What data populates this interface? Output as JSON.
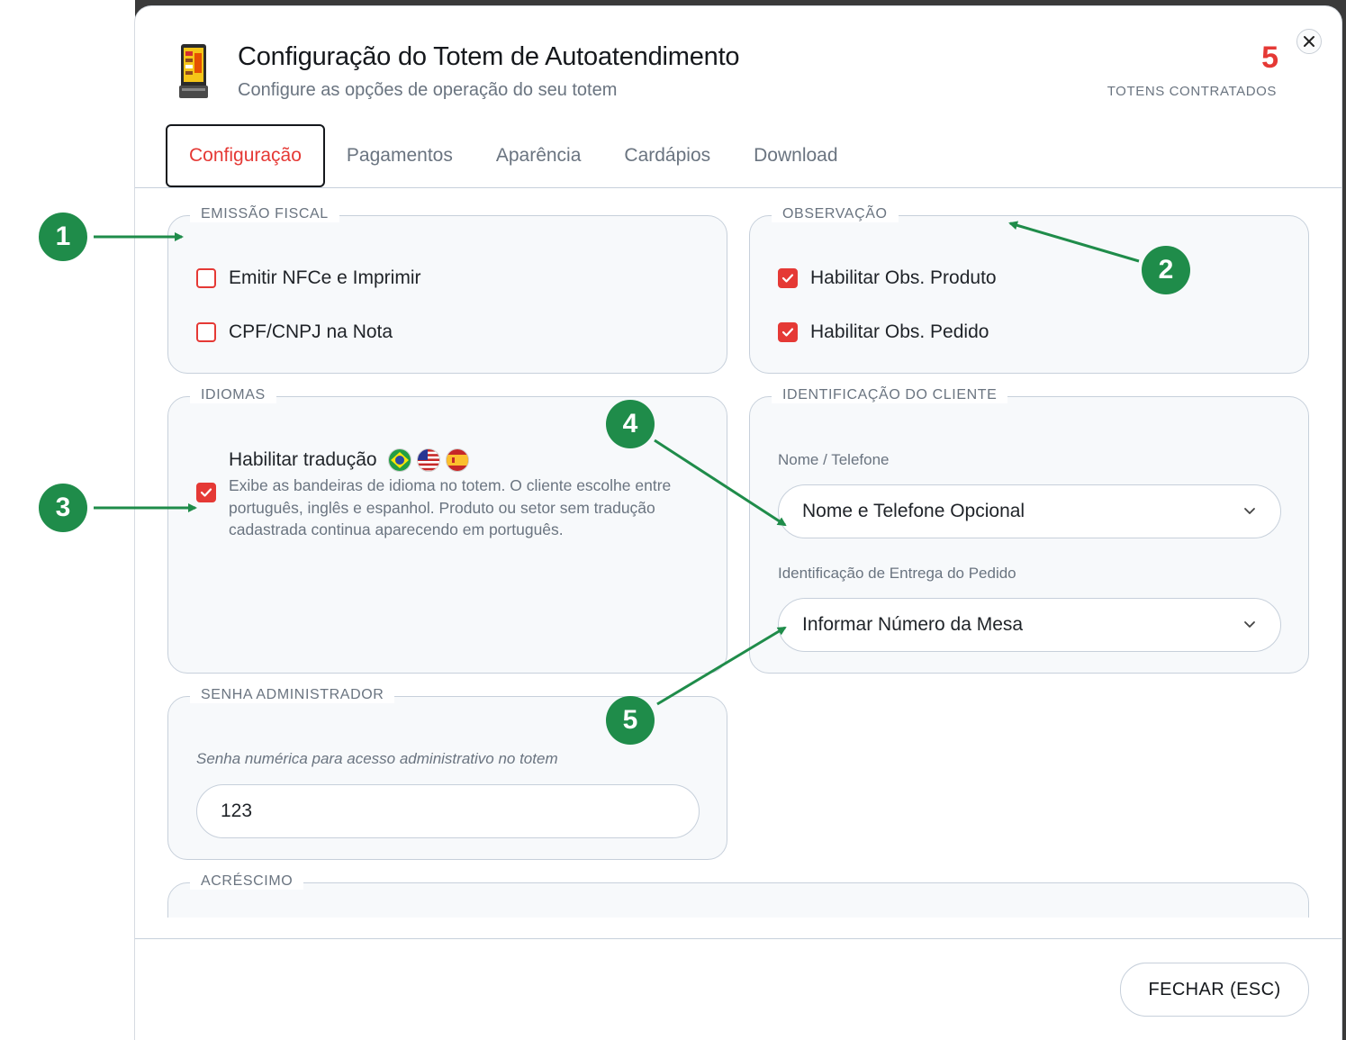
{
  "header": {
    "title": "Configuração do Totem de Autoatendimento",
    "subtitle": "Configure as opções de operação do seu totem",
    "count": "5",
    "count_label": "TOTENS CONTRATADOS",
    "close_icon": "close-icon"
  },
  "tabs": [
    {
      "label": "Configuração",
      "active": true
    },
    {
      "label": "Pagamentos",
      "active": false
    },
    {
      "label": "Aparência",
      "active": false
    },
    {
      "label": "Cardápios",
      "active": false
    },
    {
      "label": "Download",
      "active": false
    }
  ],
  "emissao_fiscal": {
    "legend": "EMISSÃO FISCAL",
    "options": [
      {
        "label": "Emitir NFCe e Imprimir",
        "checked": false
      },
      {
        "label": "CPF/CNPJ na Nota",
        "checked": false
      }
    ]
  },
  "observacao": {
    "legend": "OBSERVAÇÃO",
    "options": [
      {
        "label": "Habilitar Obs. Produto",
        "checked": true
      },
      {
        "label": "Habilitar Obs. Pedido",
        "checked": true
      }
    ]
  },
  "idiomas": {
    "legend": "IDIOMAS",
    "title": "Habilitar tradução",
    "checked": true,
    "flags": [
      "brazil-flag-icon",
      "usa-flag-icon",
      "spain-flag-icon"
    ],
    "description": "Exibe as bandeiras de idioma no totem. O cliente escolhe entre português, inglês e espanhol. Produto ou setor sem tradução cadastrada continua aparecendo em português."
  },
  "identificacao": {
    "legend": "IDENTIFICAÇÃO DO CLIENTE",
    "nome_label": "Nome / Telefone",
    "nome_value": "Nome e Telefone Opcional",
    "entrega_label": "Identificação de Entrega do Pedido",
    "entrega_value": "Informar Número da Mesa"
  },
  "senha": {
    "legend": "SENHA ADMINISTRADOR",
    "label": "Senha numérica para acesso administrativo no totem",
    "value": "123"
  },
  "acrescimo": {
    "legend": "ACRÉSCIMO"
  },
  "footer": {
    "close_label": "FECHAR (ESC)"
  },
  "annotations": [
    "1",
    "2",
    "3",
    "4",
    "5"
  ],
  "colors": {
    "accent": "#e53935",
    "annotation": "#1f8c4a"
  }
}
